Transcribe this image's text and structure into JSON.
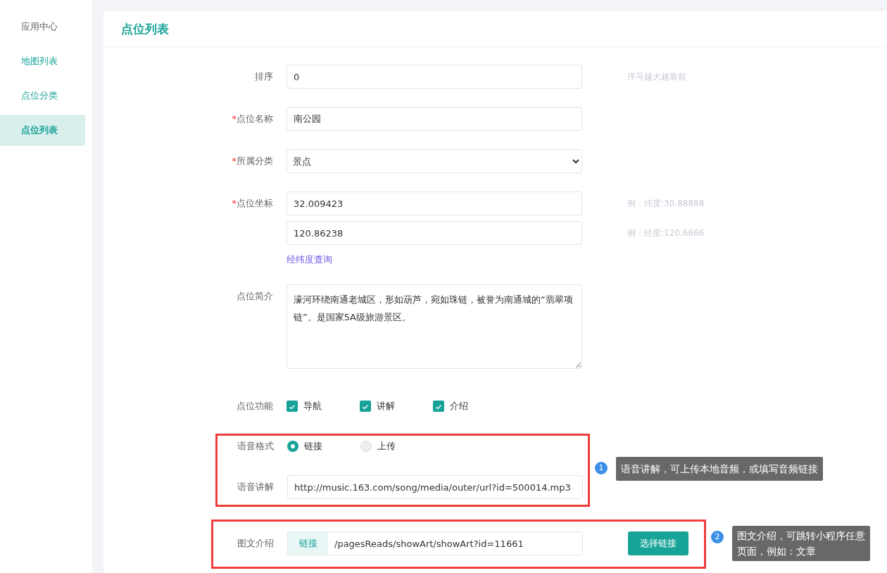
{
  "sidebar": {
    "items": [
      {
        "label": "应用中心",
        "selected": false,
        "color": "#606266"
      },
      {
        "label": "地图列表",
        "selected": false,
        "color": "#17a398"
      },
      {
        "label": "点位分类",
        "selected": false,
        "color": "#17a398"
      },
      {
        "label": "点位列表",
        "selected": true,
        "color": "#17a398"
      }
    ]
  },
  "panel": {
    "title": "点位列表"
  },
  "form": [
    {
      "kind": "input",
      "label": "排序",
      "value": "0",
      "hint": "序号越大越靠前"
    },
    {
      "kind": "input",
      "label": "点位名称",
      "required_mark": "*",
      "value": "南公园"
    },
    {
      "kind": "select",
      "label": "所属分类",
      "required_mark": "*",
      "value": "景点"
    },
    {
      "kind": "coords",
      "label": "点位坐标",
      "required_mark": "*",
      "fields": [
        {
          "value": "32.009423",
          "hint": "例：纬度:30.88888"
        },
        {
          "value": "120.86238",
          "hint": "例：经度:120.6666"
        }
      ],
      "link": "经纬度查询"
    },
    {
      "kind": "textarea",
      "label": "点位简介",
      "value": "濠河环绕南通老城区，形如葫芦，宛如珠链，被誉为南通城的“翡翠项链”。是国家5A级旅游景区。"
    },
    {
      "kind": "checkboxes",
      "label": "点位功能",
      "options": [
        {
          "label": "导航",
          "checked": true
        },
        {
          "label": "讲解",
          "checked": true
        },
        {
          "label": "介绍",
          "checked": true
        }
      ]
    }
  ],
  "callouts": [
    {
      "number": "1",
      "text": "语音讲解，可上传本地音频，或填写音频链接",
      "rows": [
        {
          "kind": "radios",
          "label": "语音格式",
          "options": [
            {
              "label": "链接",
              "selected": true
            },
            {
              "label": "上传",
              "selected": false
            }
          ]
        },
        {
          "kind": "input",
          "label": "语音讲解",
          "value": "http://music.163.com/song/media/outer/url?id=500014.mp3"
        }
      ]
    },
    {
      "number": "2",
      "text": "图文介绍，可跳转小程序任意页面，例如：文章",
      "rows": [
        {
          "kind": "link-input",
          "label": "图文介绍",
          "prefix": "链接",
          "value": "/pagesReads/showArt/showArt?id=11661",
          "button": "选择链接"
        }
      ]
    }
  ]
}
